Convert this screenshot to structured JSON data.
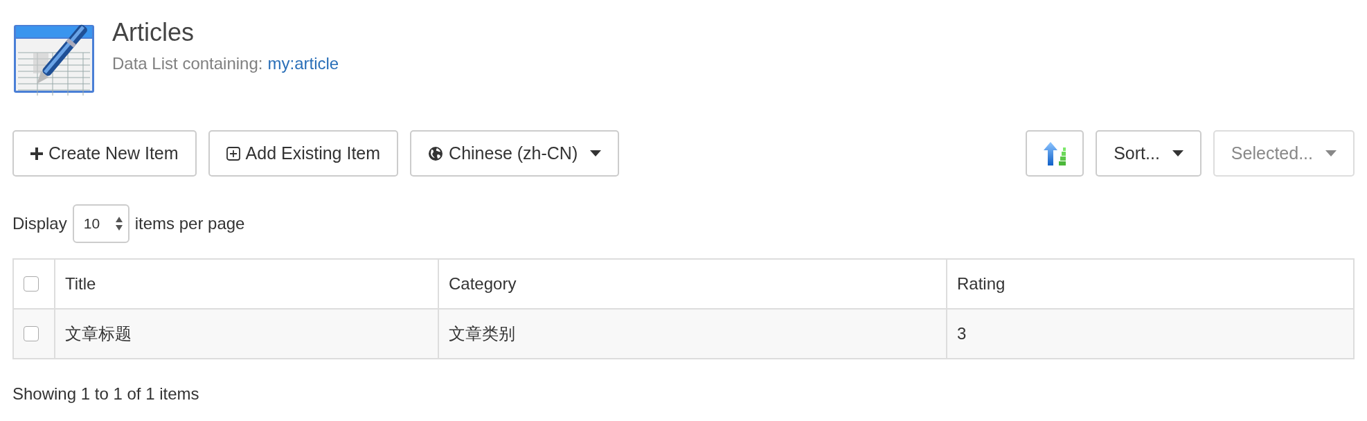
{
  "header": {
    "title": "Articles",
    "subtitle": "Data List containing:",
    "type_link": "my:article"
  },
  "toolbar": {
    "left": [
      {
        "kind": "plus",
        "label": "Create New Item",
        "disabled": false
      },
      {
        "kind": "plus-square",
        "label": "Add Existing Item",
        "disabled": false
      },
      {
        "kind": "globe",
        "label": "Chinese (zh-CN)",
        "disabled": false
      }
    ],
    "right": [
      {
        "kind": "sort-direction",
        "disabled": false
      },
      {
        "kind": "dropdown",
        "label": "Sort...",
        "disabled": false
      },
      {
        "kind": "dropdown",
        "label": "Selected...",
        "disabled": true
      }
    ]
  },
  "page_size": {
    "prefix": "Display",
    "value": "10",
    "suffix": "items per page"
  },
  "table": {
    "select_all": {
      "checked": false
    },
    "columns": [
      "Title",
      "Category",
      "Rating"
    ],
    "rows": [
      {
        "checked": false,
        "cells": [
          "文章标题",
          "文章类别",
          "3"
        ]
      }
    ]
  },
  "footer": "Showing 1 to 1 of 1 items"
}
